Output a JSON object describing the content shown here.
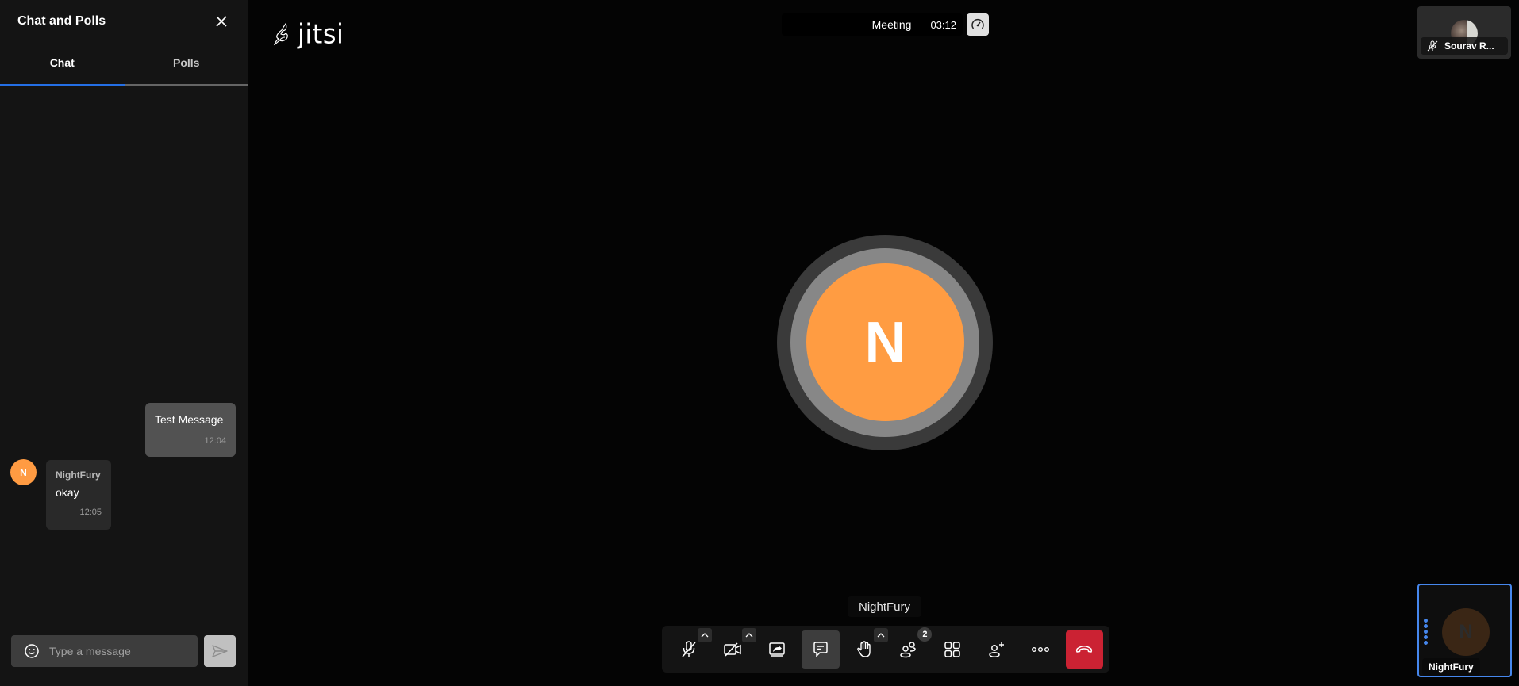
{
  "sidebar": {
    "title": "Chat and Polls",
    "tabs": [
      {
        "label": "Chat",
        "active": true
      },
      {
        "label": "Polls",
        "active": false
      }
    ],
    "messages": [
      {
        "type": "local",
        "text": "Test Message",
        "time": "12:04"
      },
      {
        "type": "remote",
        "sender": "NightFury",
        "avatar_initial": "N",
        "text": "okay",
        "time": "12:05"
      }
    ],
    "composer": {
      "placeholder": "Type a message",
      "value": ""
    }
  },
  "header": {
    "logo_text": "jitsi",
    "meeting_name": "Meeting",
    "duration": "03:12"
  },
  "participants": {
    "remote": {
      "name": "Sourav R...",
      "muted": true
    },
    "local": {
      "name": "NightFury",
      "initial": "N"
    }
  },
  "stage": {
    "dominant_initial": "N",
    "dominant_name": "NightFury",
    "avatar_color": "#ff9c42"
  },
  "toolbar": {
    "buttons": [
      {
        "name": "microphone",
        "state": "muted",
        "has_menu": true
      },
      {
        "name": "camera",
        "state": "off",
        "has_menu": true
      },
      {
        "name": "share-screen"
      },
      {
        "name": "chat",
        "active": true
      },
      {
        "name": "raise-hand",
        "has_menu": true
      },
      {
        "name": "participants",
        "badge": "2"
      },
      {
        "name": "tile-view"
      },
      {
        "name": "invite"
      },
      {
        "name": "more-actions"
      },
      {
        "name": "hangup"
      }
    ],
    "participants_count": "2"
  },
  "colors": {
    "accent": "#246fe5",
    "hangup": "#cb2233",
    "avatar": "#ff9c42"
  }
}
